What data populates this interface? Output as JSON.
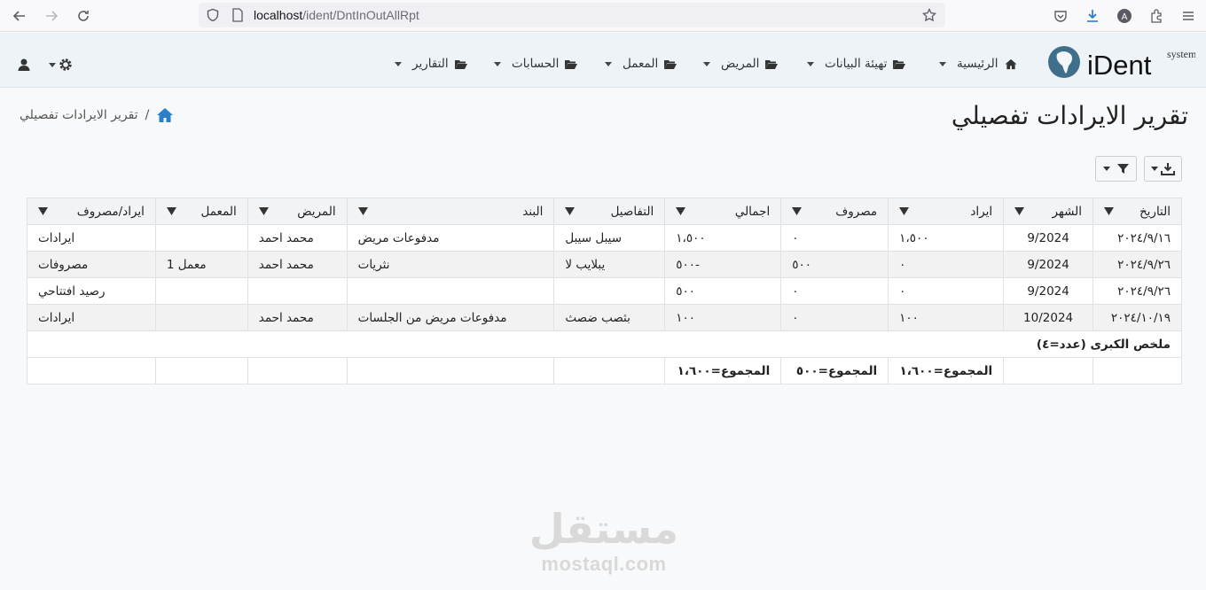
{
  "browser": {
    "url_host": "localhost",
    "url_path": "/ident/DntInOutAllRpt"
  },
  "app": {
    "logo_text": "iDent",
    "logo_sub": "system",
    "nav": [
      {
        "label": "الرئيسية",
        "icon": "home-icon"
      },
      {
        "label": "تهيئة البيانات",
        "icon": "folder-open-icon"
      },
      {
        "label": "المريض",
        "icon": "folder-open-icon"
      },
      {
        "label": "المعمل",
        "icon": "folder-open-icon"
      },
      {
        "label": "الحسابات",
        "icon": "folder-open-icon"
      },
      {
        "label": "التقارير",
        "icon": "folder-open-icon"
      }
    ]
  },
  "page": {
    "title": "تقرير الايرادات تفصيلي",
    "breadcrumb_sep": "/",
    "breadcrumb_current": "تقرير الايرادات تفصيلي"
  },
  "table": {
    "headers": [
      "التاريخ",
      "الشهر",
      "ايراد",
      "مصروف",
      "اجمالي",
      "التفاصيل",
      "البند",
      "المريض",
      "المعمل",
      "ايراد/مصروف"
    ],
    "rows": [
      [
        "٢٠٢٤/٩/١٦",
        "9/2024",
        "١،٥٠٠",
        "٠",
        "١،٥٠٠",
        "سيبل سيبل",
        "مدفوعات مريض",
        "محمد احمد",
        "",
        "ايرادات"
      ],
      [
        "٢٠٢٤/٩/٢٦",
        "9/2024",
        "٠",
        "٥٠٠",
        "-٥٠٠",
        "يبلايب لا",
        "نثريات",
        "محمد احمد",
        "معمل 1",
        "مصروفات"
      ],
      [
        "٢٠٢٤/٩/٢٦",
        "9/2024",
        "٠",
        "٠",
        "٥٠٠",
        "",
        "",
        "",
        "",
        "رصيد افتتاحي"
      ],
      [
        "٢٠٢٤/١٠/١٩",
        "10/2024",
        "١٠٠",
        "٠",
        "١٠٠",
        "بثصب ضصث",
        "مدفوعات مريض من الجلسات",
        "محمد احمد",
        "",
        "ايرادات"
      ]
    ],
    "summary_label": "ملخص الكبرى (عدد=٤)",
    "totals": {
      "income": "المجموع=١،٦٠٠",
      "expense": "المجموع=٥٠٠",
      "total": "المجموع=١،٦٠٠"
    }
  },
  "watermark": {
    "arabic": "مستقل",
    "latin": "mostaql.com"
  },
  "colors": {
    "accent": "#2a7fc9",
    "nav_bg": "#eef3f8",
    "alt_row": "#f2f2f2"
  }
}
